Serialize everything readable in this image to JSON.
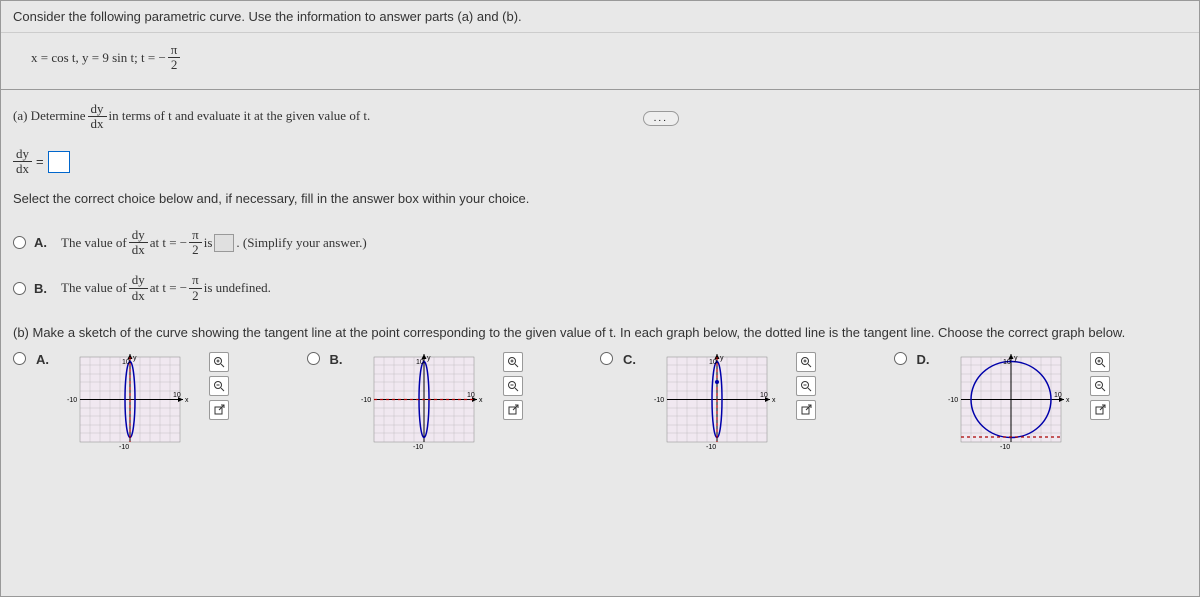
{
  "header": {
    "prompt": "Consider the following parametric curve. Use the information to answer parts (a) and (b)."
  },
  "equation": {
    "text_prefix": "x = cos t, y = 9 sin t; t = −",
    "frac_num": "π",
    "frac_den": "2"
  },
  "ellipsis": "...",
  "part_a": {
    "label": "(a) Determine",
    "d_num": "dy",
    "d_den": "dx",
    "tail": "in terms of t and evaluate it at the given value of t."
  },
  "eq_line": {
    "d_num": "dy",
    "d_den": "dx",
    "equals": "="
  },
  "select_instruction": "Select the correct choice below and, if necessary, fill in the answer box within your choice.",
  "choice_a": {
    "letter": "A.",
    "before": "The value of",
    "d_num": "dy",
    "d_den": "dx",
    "mid1": "at t = −",
    "f_num": "π",
    "f_den": "2",
    "mid2": "is",
    "after": ". (Simplify your answer.)"
  },
  "choice_b": {
    "letter": "B.",
    "before": "The value of",
    "d_num": "dy",
    "d_den": "dx",
    "mid1": "at t = −",
    "f_num": "π",
    "f_den": "2",
    "after": "is undefined."
  },
  "part_b": {
    "text": "(b) Make a sketch of the curve showing the tangent line at the point corresponding to the given value of t. In each graph below, the dotted line is the tangent line. Choose the correct graph below."
  },
  "graph_labels": {
    "a": "A.",
    "b": "B.",
    "c": "C.",
    "d": "D."
  },
  "axis": {
    "y": "y",
    "x": "x",
    "p10": "10",
    "n10": "-10"
  },
  "chart_data": {
    "type": "parametric",
    "description": "Ellipse x=cos t, y=9 sin t with tangent at t=-π/2, four graph options",
    "xlim": [
      -10,
      10
    ],
    "ylim": [
      -10,
      10
    ],
    "curve": {
      "x_formula": "cos(t)",
      "y_formula": "9*sin(t)"
    },
    "point": {
      "x": 0,
      "y": -9
    },
    "options": [
      {
        "label": "A",
        "tangent_line": {
          "orientation": "vertical",
          "x": 0
        }
      },
      {
        "label": "B",
        "tangent_line": {
          "orientation": "horizontal",
          "y": 0
        }
      },
      {
        "label": "C",
        "tangent_line": {
          "orientation": "vertical",
          "x": 0
        }
      },
      {
        "label": "D",
        "tangent_line": {
          "orientation": "horizontal",
          "y": -9
        }
      }
    ]
  }
}
